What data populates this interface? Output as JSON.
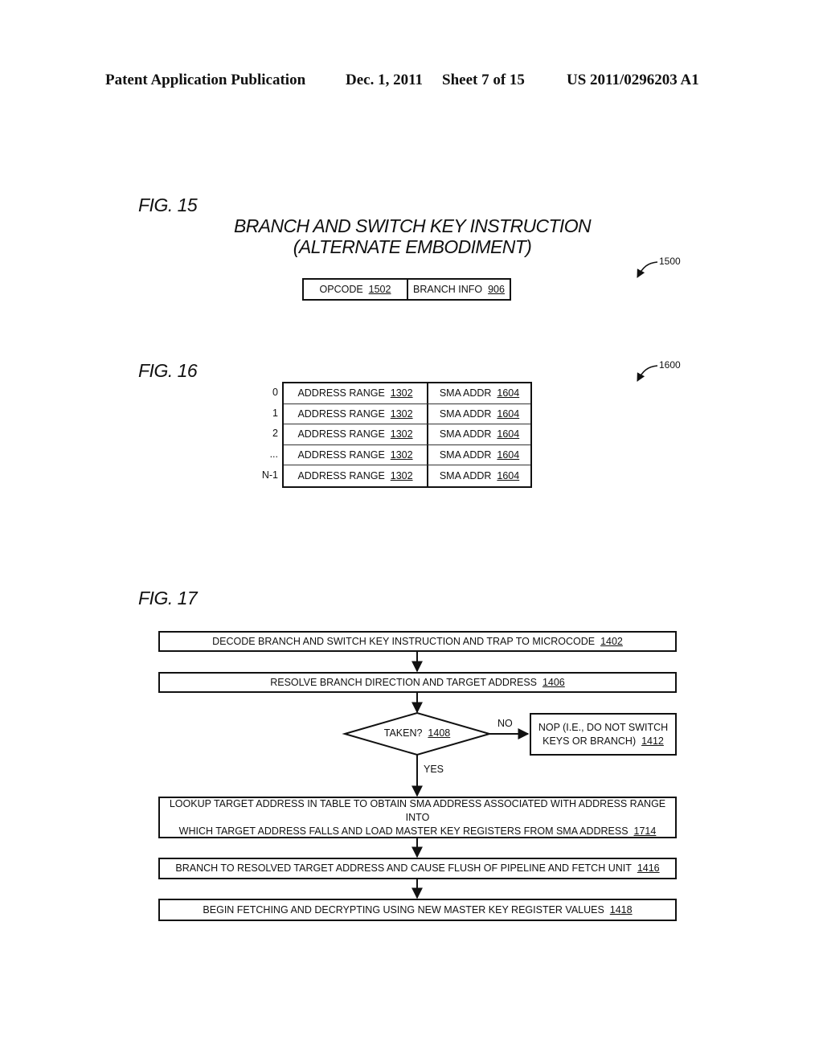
{
  "header": {
    "publication": "Patent Application Publication",
    "date": "Dec. 1, 2011",
    "sheet": "Sheet 7 of 15",
    "patent_number": "US 2011/0296203 A1"
  },
  "fig15": {
    "label": "FIG. 15",
    "title_line1": "BRANCH AND SWITCH KEY INSTRUCTION",
    "title_line2": "(ALTERNATE EMBODIMENT)",
    "ref": "1500",
    "fields": [
      {
        "name": "OPCODE",
        "ref": "1502"
      },
      {
        "name": "BRANCH INFO",
        "ref": "906"
      }
    ]
  },
  "fig16": {
    "label": "FIG. 16",
    "ref": "1600",
    "rows": [
      {
        "index": "0",
        "col1": "ADDRESS RANGE",
        "col1_ref": "1302",
        "col2": "SMA ADDR",
        "col2_ref": "1604"
      },
      {
        "index": "1",
        "col1": "ADDRESS RANGE",
        "col1_ref": "1302",
        "col2": "SMA ADDR",
        "col2_ref": "1604"
      },
      {
        "index": "2",
        "col1": "ADDRESS RANGE",
        "col1_ref": "1302",
        "col2": "SMA ADDR",
        "col2_ref": "1604"
      },
      {
        "index": "...",
        "col1": "ADDRESS RANGE",
        "col1_ref": "1302",
        "col2": "SMA ADDR",
        "col2_ref": "1604"
      },
      {
        "index": "N-1",
        "col1": "ADDRESS RANGE",
        "col1_ref": "1302",
        "col2": "SMA ADDR",
        "col2_ref": "1604"
      }
    ]
  },
  "fig17": {
    "label": "FIG. 17",
    "steps": {
      "decode": {
        "text": "DECODE BRANCH AND SWITCH KEY INSTRUCTION AND TRAP TO MICROCODE",
        "ref": "1402"
      },
      "resolve": {
        "text": "RESOLVE BRANCH DIRECTION AND TARGET ADDRESS",
        "ref": "1406"
      },
      "taken": {
        "text": "TAKEN?",
        "ref": "1408"
      },
      "nop_line1": "NOP (I.E., DO NOT SWITCH",
      "nop_line2": "KEYS OR BRANCH)",
      "nop_ref": "1412",
      "lookup_line1": "LOOKUP TARGET ADDRESS IN TABLE TO OBTAIN SMA ADDRESS ASSOCIATED WITH ADDRESS RANGE INTO",
      "lookup_line2": "WHICH TARGET ADDRESS FALLS AND LOAD MASTER KEY REGISTERS FROM SMA ADDRESS",
      "lookup_ref": "1714",
      "branch": {
        "text": "BRANCH TO RESOLVED TARGET ADDRESS AND CAUSE FLUSH OF PIPELINE AND FETCH UNIT",
        "ref": "1416"
      },
      "fetch": {
        "text": "BEGIN FETCHING AND DECRYPTING USING NEW MASTER KEY REGISTER VALUES",
        "ref": "1418"
      }
    },
    "edge_labels": {
      "no": "NO",
      "yes": "YES"
    }
  }
}
